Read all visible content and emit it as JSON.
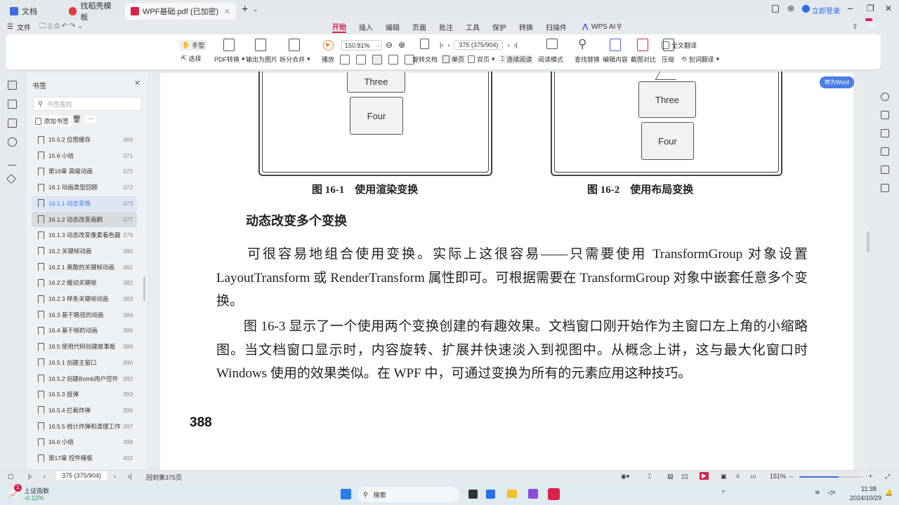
{
  "tabs": [
    {
      "label": "文档",
      "color": "#3a6fe0"
    },
    {
      "label": "找稻壳模板",
      "color": "#e5383b"
    },
    {
      "label": "WPF基础.pdf (已加密)",
      "color": "#d8234b",
      "active": true
    }
  ],
  "titlebar": {
    "login": "立即登录",
    "share": "分享"
  },
  "menu": {
    "file": "文件",
    "items": [
      "开始",
      "插入",
      "编辑",
      "页面",
      "批注",
      "工具",
      "保护",
      "转换",
      "扫描件"
    ],
    "active": "开始",
    "ai": "WPS AI",
    "accent": "#d8234b"
  },
  "ribbon": {
    "hand": "手型",
    "select": "选择",
    "pdf_convert": "PDF转换",
    "export_image": "输出为图片",
    "split_merge": "拆分合并",
    "play": "播放",
    "zoom": "150.81%",
    "rotate": "旋转文档",
    "single": "单页",
    "double": "双页",
    "continuous": "连续阅读",
    "page_box": "375 (375/904)",
    "read_mode": "阅读模式",
    "find_replace": "查找替换",
    "edit_content": "编辑内容",
    "screenshot_compare": "截图对比",
    "compress": "压缩",
    "full_translate": "全文翻译",
    "word_translate": "划词翻译"
  },
  "sidebar": {
    "title": "书签",
    "search_placeholder": "书签查找",
    "add_bookmark": "添加书签",
    "more": "···",
    "items": [
      {
        "label": "15.5.2 位图缓存",
        "page": "369"
      },
      {
        "label": "15.6 小结",
        "page": "371"
      },
      {
        "label": "第16章 高级动画",
        "page": "372"
      },
      {
        "label": "16.1 动画类型回顾",
        "page": "372"
      },
      {
        "label": "16.1.1 动态变换",
        "page": "373",
        "state": "selected"
      },
      {
        "label": "16.1.2 动态改变画刷",
        "page": "377",
        "state": "hover"
      },
      {
        "label": "16.1.3 动态改变像素着色器",
        "page": "379"
      },
      {
        "label": "16.2 关键帧动画",
        "page": "380"
      },
      {
        "label": "16.2.1 离散的关键帧动画",
        "page": "382"
      },
      {
        "label": "16.2.2 缓动关键帧",
        "page": "382"
      },
      {
        "label": "16.2.3 样条关键帧动画",
        "page": "383"
      },
      {
        "label": "16.3 基于路径的动画",
        "page": "384"
      },
      {
        "label": "16.4 基于帧的动画",
        "page": "386"
      },
      {
        "label": "16.5 使用代码创建故事板",
        "page": "389"
      },
      {
        "label": "16.5.1 创建主窗口",
        "page": "390"
      },
      {
        "label": "16.5.2 创建Bomb用户控件",
        "page": "392"
      },
      {
        "label": "16.5.3 投弹",
        "page": "393"
      },
      {
        "label": "16.5.4 拦截炸弹",
        "page": "396"
      },
      {
        "label": "16.5.5 统计炸弹和清理工作",
        "page": "397"
      },
      {
        "label": "16.6 小结",
        "page": "399"
      },
      {
        "label": "第17章 控件模板",
        "page": "402"
      }
    ]
  },
  "document": {
    "fig1": {
      "boxes": [
        "Three",
        "Four"
      ],
      "caption": "图 16-1　使用渲染变换"
    },
    "fig2": {
      "boxes": [
        "Three",
        "Four"
      ],
      "caption": "图 16-2　使用布局变换"
    },
    "heading": "动态改变多个变换",
    "para1": "　　可很容易地组合使用变换。实际上这很容易——只需要使用 TransformGroup 对象设置 LayoutTransform 或 RenderTransform 属性即可。可根据需要在 TransformGroup 对象中嵌套任意多个变换。",
    "para2": "　　图 16-3 显示了一个使用两个变换创建的有趣效果。文档窗口刚开始作为主窗口左上角的小缩略图。当文档窗口显示时，内容旋转、扩展并快速淡入到视图中。从概念上讲，这与最大化窗口时 Windows 使用的效果类似。在 WPF 中，可通过变换为所有的元素应用这种技巧。",
    "page_number": "388"
  },
  "to_word": "转为Word",
  "status": {
    "page_box": "375 (375/904)",
    "back": "回到第375页",
    "zoom": "151%",
    "zoom_level": 0.62
  },
  "taskbar": {
    "stock_name": "上证指数",
    "stock_change": "-0.12%",
    "badge": "1",
    "search": "搜索",
    "time": "11:38",
    "date": "2024/10/29"
  }
}
